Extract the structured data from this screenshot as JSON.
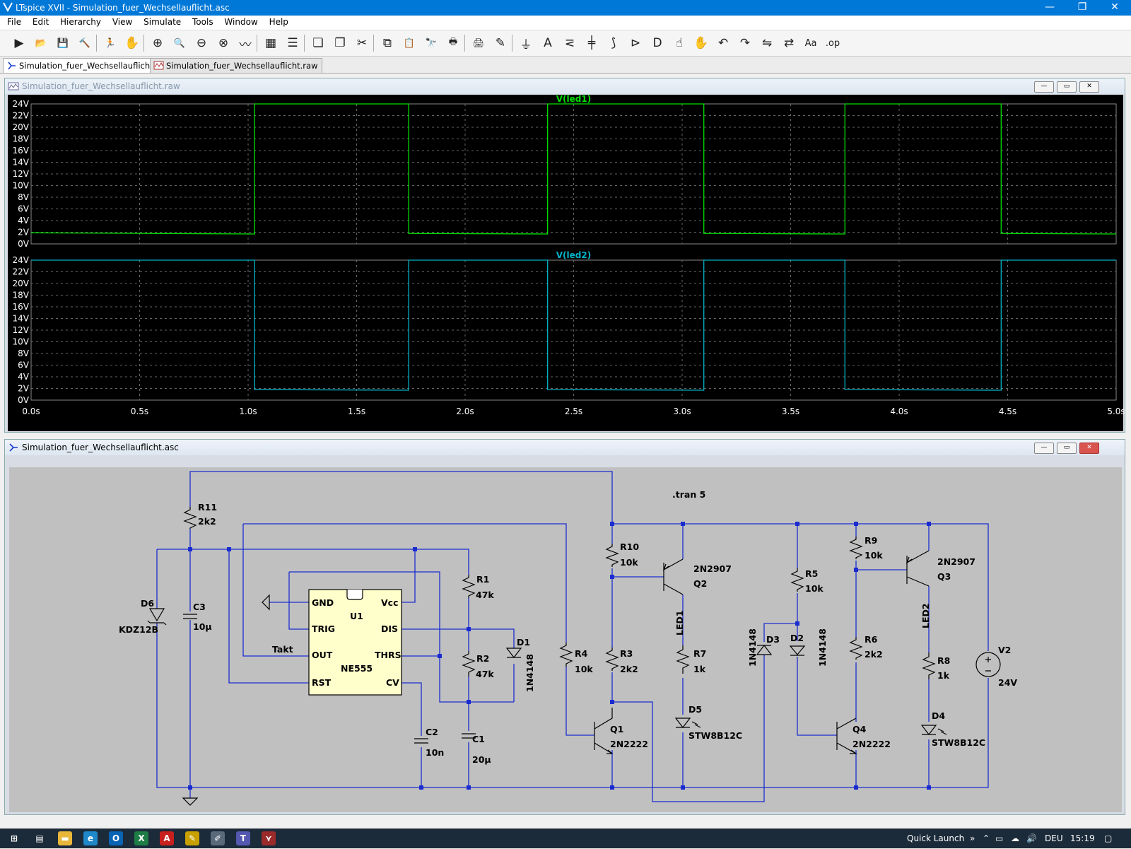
{
  "window": {
    "title": "LTspice XVII - Simulation_fuer_Wechsellauflicht.asc",
    "min": "—",
    "max": "❐",
    "close": "✕"
  },
  "menu": [
    "File",
    "Edit",
    "Hierarchy",
    "View",
    "Simulate",
    "Tools",
    "Window",
    "Help"
  ],
  "toolbar": {
    "icons": [
      "run-icon",
      "open-icon",
      "save-icon",
      "control-panel-icon",
      "run-stop-icon",
      "halt-icon",
      "zoom-in-icon",
      "zoom-pan-icon",
      "zoom-out-icon",
      "zoom-fit-icon",
      "autorange-icon",
      "probe-icon",
      "tile-horizontal-icon",
      "tile-vertical-icon",
      "cascade-icon",
      "cut-icon",
      "copy-icon",
      "paste-icon",
      "find-icon",
      "print-setup-icon",
      "print-icon",
      "draw-wire-icon",
      "ground-icon",
      "label-net-icon",
      "resistor-icon",
      "capacitor-icon",
      "inductor-icon",
      "diode-icon",
      "component-icon",
      "move-icon",
      "drag-icon",
      "undo-icon",
      "redo-icon",
      "rotate-icon",
      "mirror-icon",
      "text-icon",
      "spice-directive-icon"
    ],
    "glyphs": [
      "▶",
      "📂",
      "💾",
      "🔨",
      "🏃",
      "✋",
      "⊕",
      "🔍",
      "⊖",
      "⊗",
      "〰",
      "▦",
      "☰",
      "❏",
      "❐",
      "✂",
      "⧉",
      "📋",
      "🔭",
      "🖶",
      "🖨",
      "✎",
      "⏚",
      "A",
      "⋜",
      "╪",
      "⟆",
      "⊳",
      "D",
      "☝",
      "✋",
      "↶",
      "↷",
      "⇋",
      "⇄",
      "Aa",
      ".op"
    ]
  },
  "tabs": [
    {
      "label": "Simulation_fuer_Wechsellauflicht.asc",
      "active": true
    },
    {
      "label": "Simulation_fuer_Wechsellauflicht.raw",
      "active": false
    }
  ],
  "waveform_window": {
    "title": "Simulation_fuer_Wechsellauflicht.raw",
    "chart_data": {
      "type": "line",
      "x_unit": "s",
      "xlim": [
        0,
        5
      ],
      "x_ticks": [
        "0.0s",
        "0.5s",
        "1.0s",
        "1.5s",
        "2.0s",
        "2.5s",
        "3.0s",
        "3.5s",
        "4.0s",
        "4.5s",
        "5.0s"
      ],
      "y_ticks": [
        "24V",
        "22V",
        "20V",
        "18V",
        "16V",
        "14V",
        "12V",
        "10V",
        "8V",
        "6V",
        "4V",
        "2V",
        "0V"
      ],
      "ylim": [
        0,
        24
      ],
      "grid": true,
      "panes": [
        {
          "name": "V(led1)",
          "color": "#00e000",
          "points": [
            [
              0,
              1.9
            ],
            [
              1.03,
              1.7
            ],
            [
              1.03,
              24
            ],
            [
              1.74,
              24
            ],
            [
              1.74,
              1.8
            ],
            [
              2.38,
              1.7
            ],
            [
              2.38,
              24
            ],
            [
              3.1,
              24
            ],
            [
              3.1,
              1.8
            ],
            [
              3.75,
              1.7
            ],
            [
              3.75,
              24
            ],
            [
              4.47,
              24
            ],
            [
              4.47,
              1.8
            ],
            [
              5.0,
              1.7
            ]
          ]
        },
        {
          "name": "V(led2)",
          "color": "#00b4c8",
          "points": [
            [
              0,
              24
            ],
            [
              1.03,
              24
            ],
            [
              1.03,
              1.8
            ],
            [
              1.74,
              1.7
            ],
            [
              1.74,
              24
            ],
            [
              2.38,
              24
            ],
            [
              2.38,
              1.8
            ],
            [
              3.1,
              1.7
            ],
            [
              3.1,
              24
            ],
            [
              3.75,
              24
            ],
            [
              3.75,
              1.8
            ],
            [
              4.47,
              1.7
            ],
            [
              4.47,
              24
            ],
            [
              5.0,
              24
            ]
          ]
        }
      ]
    }
  },
  "schematic_window": {
    "title": "Simulation_fuer_Wechsellauflicht.asc",
    "directive": ".tran 5",
    "labels": {
      "R11": "R11",
      "R11v": "2k2",
      "C3": "C3",
      "C3v": "10µ",
      "D6": "D6",
      "D6v": "KDZ12B",
      "GND": "GND",
      "Vcc": "Vcc",
      "U1": "U1",
      "TRIG": "TRIG",
      "DIS": "DIS",
      "OUT": "OUT",
      "THRS": "THRS",
      "RST": "RST",
      "CV": "CV",
      "NE555": "NE555",
      "Takt": "Takt",
      "R1": "R1",
      "R1v": "47k",
      "R2": "R2",
      "R2v": "47k",
      "D1": "D1",
      "D1v": "1N4148",
      "C2": "C2",
      "C2v": "10n",
      "C1": "C1",
      "C1v": "20µ",
      "R4": "R4",
      "R4v": "10k",
      "R10": "R10",
      "R10v": "10k",
      "R3": "R3",
      "R3v": "2k2",
      "Q1": "Q1",
      "Q1v": "2N2222",
      "Q2": "Q2",
      "Q2v": "2N2907",
      "LED1": "LED1",
      "R7": "R7",
      "R7v": "1k",
      "D5": "D5",
      "D5v": "STW8B12C",
      "D3": "D3",
      "D3v": "1N4148",
      "D2": "D2",
      "D2v": "1N4148",
      "R5": "R5",
      "R5v": "10k",
      "R9": "R9",
      "R9v": "10k",
      "R6": "R6",
      "R6v": "2k2",
      "Q3": "Q3",
      "Q3v": "2N2907",
      "Q4": "Q4",
      "Q4v": "2N2222",
      "LED2": "LED2",
      "R8": "R8",
      "R8v": "1k",
      "D4": "D4",
      "D4v": "STW8B12C",
      "V2": "V2",
      "V2v": "24V"
    }
  },
  "taskbar": {
    "quick_launch": "Quick Launch",
    "lang": "DEU",
    "time": "15:19",
    "apps": [
      {
        "name": "start-icon",
        "glyph": "⊞",
        "color": "#1c2b3a"
      },
      {
        "name": "task-view-icon",
        "glyph": "▤",
        "color": "#1c2b3a"
      },
      {
        "name": "explorer-icon",
        "glyph": "▬",
        "color": "#e8b73a"
      },
      {
        "name": "edge-icon",
        "glyph": "e",
        "color": "#1e88c9"
      },
      {
        "name": "outlook-icon",
        "glyph": "O",
        "color": "#0a64b4"
      },
      {
        "name": "excel-icon",
        "glyph": "X",
        "color": "#1e7c45"
      },
      {
        "name": "acrobat-icon",
        "glyph": "A",
        "color": "#c8201e"
      },
      {
        "name": "pen-app-icon",
        "glyph": "✎",
        "color": "#c8a000"
      },
      {
        "name": "pencil-app-icon",
        "glyph": "✐",
        "color": "#5a6a7a"
      },
      {
        "name": "teams-icon",
        "glyph": "T",
        "color": "#5458b0"
      },
      {
        "name": "ltspice-icon",
        "glyph": "⋎",
        "color": "#9b2a2a"
      }
    ]
  }
}
